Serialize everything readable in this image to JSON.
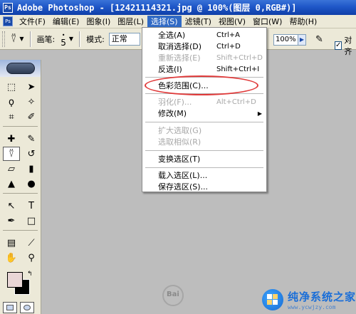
{
  "title_bar": {
    "app_title": "Adobe Photoshop - [12421114321.jpg @ 100%(图层 0,RGB#)]",
    "app_icon": "photoshop-logo-icon"
  },
  "menu_bar": {
    "items": [
      {
        "label": "文件(F)"
      },
      {
        "label": "编辑(E)"
      },
      {
        "label": "图象(I)"
      },
      {
        "label": "图层(L)"
      },
      {
        "label": "选择(S)"
      },
      {
        "label": "滤镜(T)"
      },
      {
        "label": "视图(V)"
      },
      {
        "label": "窗口(W)"
      },
      {
        "label": "帮助(H)"
      }
    ],
    "active_item": "选择(S)"
  },
  "options_bar": {
    "brush_label": "画笔:",
    "brush_size": "5",
    "mode_label": "模式:",
    "mode_value": "正常",
    "opacity_value": "100%",
    "aligned_label": "对齐",
    "aligned_checked": "✓"
  },
  "select_menu": {
    "items": [
      {
        "label": "全选(A)",
        "shortcut": "Ctrl+A",
        "disabled": false
      },
      {
        "label": "取消选择(D)",
        "shortcut": "Ctrl+D",
        "disabled": false
      },
      {
        "label": "重新选择(E)",
        "shortcut": "Shift+Ctrl+D",
        "disabled": true
      },
      {
        "label": "反选(I)",
        "shortcut": "Shift+Ctrl+I",
        "disabled": false
      },
      {
        "label": "色彩范围(C)...",
        "shortcut": "",
        "disabled": false
      },
      {
        "label": "羽化(F)...",
        "shortcut": "Alt+Ctrl+D",
        "disabled": true
      },
      {
        "label": "修改(M)",
        "shortcut": "",
        "disabled": false,
        "submenu": true
      },
      {
        "label": "扩大选取(G)",
        "shortcut": "",
        "disabled": true
      },
      {
        "label": "选取相似(R)",
        "shortcut": "",
        "disabled": true
      },
      {
        "label": "变换选区(T)",
        "shortcut": "",
        "disabled": false
      },
      {
        "label": "载入选区(L)...",
        "shortcut": "",
        "disabled": false
      },
      {
        "label": "保存选区(S)...",
        "shortcut": "",
        "disabled": false
      }
    ],
    "highlighted_item": "色彩范围(C)...",
    "highlight_color": "#e03a3a"
  },
  "toolbox": {
    "foreground_color": "#e9d6d6",
    "background_color": "#000000"
  },
  "watermark": {
    "brand_name": "纯净系统之家",
    "brand_url": "www.ycwjzy.com",
    "left_mark_text": "Bai"
  },
  "colors": {
    "title_bar_blue": "#1f57c8",
    "menu_highlight": "#316ac5",
    "canvas_gray": "#bdbdbd",
    "panel_beige": "#ece9d8"
  }
}
